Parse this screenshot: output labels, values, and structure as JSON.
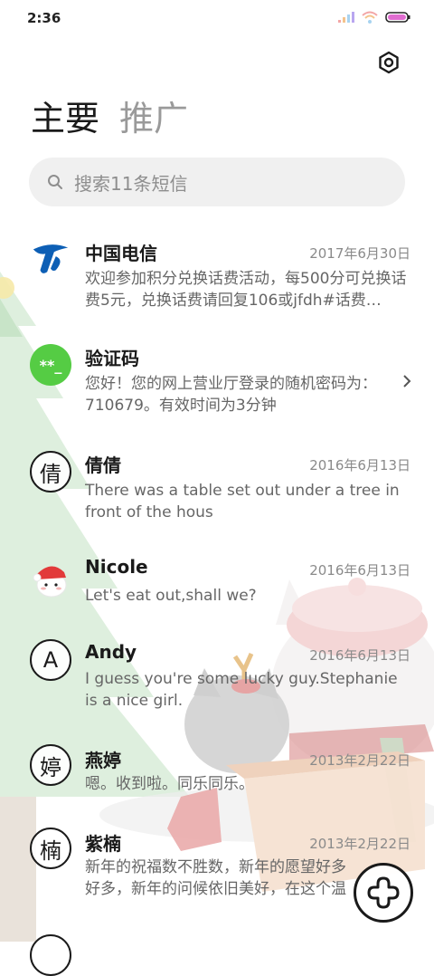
{
  "status": {
    "time": "2:36"
  },
  "tabs": [
    {
      "label": "主要",
      "active": true
    },
    {
      "label": "推广",
      "active": false
    }
  ],
  "search": {
    "placeholder": "搜索11条短信"
  },
  "messages": [
    {
      "sender": "中国电信",
      "date": "2017年6月30日",
      "preview": "欢迎参加积分兑换话费活动，每500分可兑换话费5元，兑换话费请回复106或jfdh#话费…",
      "avatar": "china-telecom-logo"
    },
    {
      "sender": "验证码",
      "date": "",
      "preview": "您好！您的网上营业厅登录的随机密码为：710679。有效时间为3分钟",
      "avatar_text": "**_",
      "avatar_color": "#55cc44"
    },
    {
      "sender": "倩倩",
      "date": "2016年6月13日",
      "preview": "There was a table set out under a tree in front of the hous",
      "avatar_text": "倩"
    },
    {
      "sender": "Nicole",
      "date": "2016年6月13日",
      "preview": "Let's eat out,shall we?",
      "avatar": "cartoon-cat-avatar"
    },
    {
      "sender": "Andy",
      "date": "2016年6月13日",
      "preview": "I guess you're some lucky guy.Stephanie is a nice girl.",
      "avatar_text": "A"
    },
    {
      "sender": "燕婷",
      "date": "2013年2月22日",
      "preview": "嗯。收到啦。同乐同乐。",
      "avatar_text": "婷"
    },
    {
      "sender": "紫楠",
      "date": "2013年2月22日",
      "preview": "新年的祝福数不胜数，新年的愿望好多好多，新年的问候依旧美好，在这个温馨的时刻",
      "avatar_text": "楠"
    }
  ],
  "colors": {
    "accent_green": "#55cc44",
    "telecom_blue": "#0d5fb5"
  }
}
